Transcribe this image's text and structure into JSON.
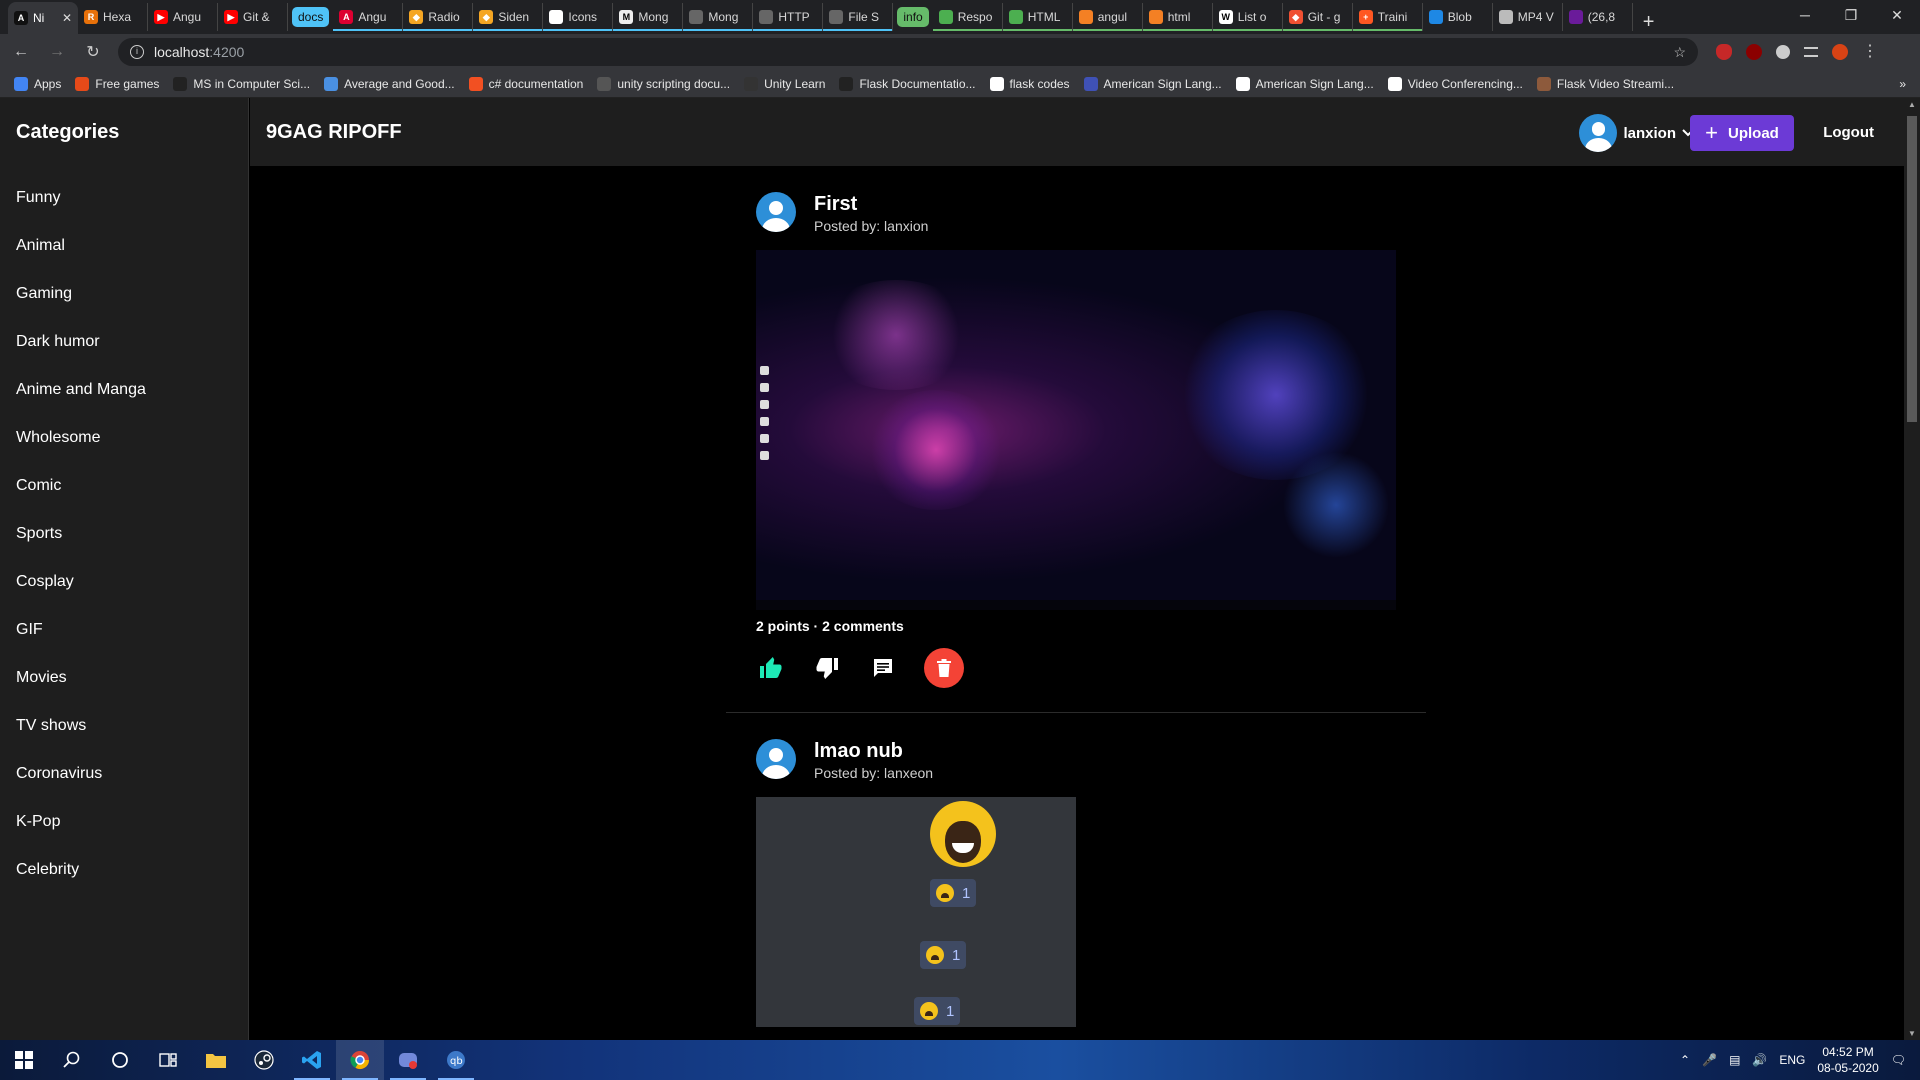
{
  "browser": {
    "tabs": [
      {
        "label": "Ni",
        "fav_color": "#111111",
        "fav_text": "A",
        "active": true
      },
      {
        "label": "Hexa",
        "fav_color": "#e8710a",
        "fav_text": "R"
      },
      {
        "label": "Angu",
        "fav_color": "#ff0000",
        "fav_text": "▶"
      },
      {
        "label": "Git &",
        "fav_color": "#ff0000",
        "fav_text": "▶"
      },
      {
        "group": "docs",
        "group_color": "#4fc3f7"
      },
      {
        "label": "Angu",
        "fav_color": "#dd0031",
        "fav_text": "A",
        "group_style": "cyan"
      },
      {
        "label": "Radio",
        "fav_color": "#f5a623",
        "fav_text": "◆",
        "group_style": "cyan"
      },
      {
        "label": "Siden",
        "fav_color": "#f5a623",
        "fav_text": "◆",
        "group_style": "cyan"
      },
      {
        "label": "Icons",
        "fav_color": "#ffffff",
        "fav_text": "",
        "group_style": "cyan"
      },
      {
        "label": "Mong",
        "fav_color": "#eeeeee",
        "fav_text": "M",
        "group_style": "cyan"
      },
      {
        "label": "Mong",
        "fav_color": "#666666",
        "fav_text": "",
        "group_style": "cyan"
      },
      {
        "label": "HTTP",
        "fav_color": "#666666",
        "fav_text": "",
        "group_style": "cyan"
      },
      {
        "label": "File S",
        "fav_color": "#666666",
        "fav_text": "",
        "group_style": "cyan"
      },
      {
        "group": "info",
        "group_color": "#66bb6a"
      },
      {
        "label": "Respo",
        "fav_color": "#4caf50",
        "fav_text": "",
        "group_style": "green"
      },
      {
        "label": "HTML",
        "fav_color": "#4caf50",
        "fav_text": "",
        "group_style": "green"
      },
      {
        "label": "angul",
        "fav_color": "#f48024",
        "fav_text": "",
        "group_style": "green"
      },
      {
        "label": "html",
        "fav_color": "#f48024",
        "fav_text": "",
        "group_style": "green"
      },
      {
        "label": "List o",
        "fav_color": "#ffffff",
        "fav_text": "W",
        "group_style": "green"
      },
      {
        "label": "Git - g",
        "fav_color": "#f05032",
        "fav_text": "◆",
        "group_style": "green"
      },
      {
        "label": "Traini",
        "fav_color": "#ff5722",
        "fav_text": "+",
        "group_style": "green"
      },
      {
        "label": "Blob",
        "fav_color": "#1e88e5",
        "fav_text": ""
      },
      {
        "label": "MP4 V",
        "fav_color": "#bbbbbb",
        "fav_text": ""
      },
      {
        "label": "(26,8",
        "fav_color": "#6a1b9a",
        "fav_text": ""
      }
    ],
    "url_host": "localhost",
    "url_port": ":4200",
    "window_controls": [
      "─",
      "❐",
      "✕"
    ],
    "bookmarks": [
      {
        "label": "Apps",
        "color": "#4285f4"
      },
      {
        "label": "Free games",
        "color": "#e64a19"
      },
      {
        "label": "MS in Computer Sci...",
        "color": "#222222"
      },
      {
        "label": "Average and Good...",
        "color": "#4a90e2"
      },
      {
        "label": "c# documentation",
        "color": "#f25022"
      },
      {
        "label": "unity scripting docu...",
        "color": "#555555"
      },
      {
        "label": "Unity Learn",
        "color": "#333333"
      },
      {
        "label": "Flask Documentatio...",
        "color": "#222222"
      },
      {
        "label": "flask codes",
        "color": "#ffffff"
      },
      {
        "label": "American Sign Lang...",
        "color": "#3f51b5"
      },
      {
        "label": "American Sign Lang...",
        "color": "#ffffff"
      },
      {
        "label": "Video Conferencing...",
        "color": "#ffffff"
      },
      {
        "label": "Flask Video Streami...",
        "color": "#8d5a3c"
      }
    ],
    "bookmarks_overflow": "»"
  },
  "sidebar": {
    "title": "Categories",
    "categories": [
      "Funny",
      "Animal",
      "Gaming",
      "Dark humor",
      "Anime and Manga",
      "Wholesome",
      "Comic",
      "Sports",
      "Cosplay",
      "GIF",
      "Movies",
      "TV shows",
      "Coronavirus",
      "K-Pop",
      "Celebrity"
    ]
  },
  "header": {
    "brand": "9GAG RIPOFF",
    "username": "lanxion",
    "upload_label": "Upload",
    "logout_label": "Logout"
  },
  "posts": [
    {
      "title": "First",
      "author_prefix": "Posted by: ",
      "author": "lanxion",
      "stats": "2 points · 2 comments",
      "upvoted": true,
      "accent": "#1de9b6"
    },
    {
      "title": "lmao nub",
      "author_prefix": "Posted by: ",
      "author": "lanxeon",
      "reactions": [
        "1",
        "1",
        "1"
      ]
    }
  ],
  "taskbar": {
    "apps": [
      "windows-start",
      "search",
      "cortana",
      "task-view",
      "file-explorer",
      "steam",
      "vscode",
      "chrome",
      "discord",
      "qbittorrent"
    ],
    "language": "ENG",
    "time": "04:52 PM",
    "date": "08-05-2020"
  },
  "colors": {
    "accent_purple": "#6c3ad6",
    "delete_red": "#f44336",
    "upvote_teal": "#1de9b6",
    "avatar_blue": "#2d8fd8"
  }
}
